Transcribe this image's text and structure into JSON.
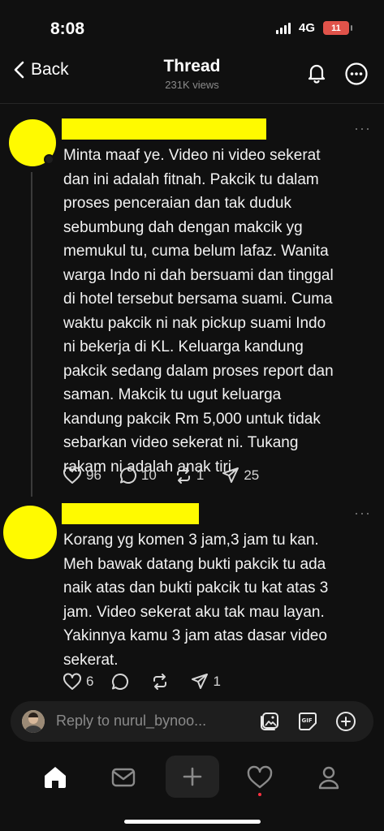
{
  "status_bar": {
    "time": "8:08",
    "network": "4G",
    "battery": "11"
  },
  "header": {
    "back_label": "Back",
    "title": "Thread",
    "views": "231K views"
  },
  "posts": [
    {
      "text": "Minta maaf ye. Video ni video sekerat\ndan ini adalah fitnah. Pakcik tu dalam\nproses penceraian dan tak duduk\nsebumbung dah dengan makcik yg\nmemukul tu, cuma belum lafaz. Wanita\nwarga Indo ni dah bersuami dan tinggal\ndi hotel tersebut bersama suami. Cuma\nwaktu pakcik ni nak pickup suami Indo\nni bekerja di KL. Keluarga kandung\npakcik sedang dalam proses report dan\nsaman. Makcik tu ugut keluarga\nkandung pakcik Rm 5,000 untuk tidak\nsebarkan video sekerat ni. Tukang\nrakam ni adalah anak tiri.",
      "likes": "96",
      "replies": "10",
      "reposts": "1",
      "shares": "25"
    },
    {
      "text": "Korang yg komen 3 jam,3 jam tu kan.\nMeh bawak datang bukti pakcik tu ada\nnaik atas dan bukti pakcik tu kat atas 3\njam. Video sekerat aku tak mau layan.\nYakinnya kamu 3 jam atas dasar video\nsekerat.",
      "likes": "6",
      "replies": "",
      "reposts": "",
      "shares": "1"
    }
  ],
  "reply_bar": {
    "placeholder": "Reply to nurul_bynoo..."
  },
  "icons": {
    "back": "chevron-left-icon",
    "bell": "bell-icon",
    "more": "more-circle-icon",
    "like": "heart-icon",
    "reply": "comment-icon",
    "repost": "repost-icon",
    "share": "send-icon",
    "gallery": "gallery-icon",
    "gif": "gif-icon",
    "add": "plus-circle-icon",
    "home": "home-icon",
    "inbox": "inbox-icon",
    "create": "plus-icon",
    "activity": "heart-icon",
    "profile": "profile-icon"
  },
  "colors": {
    "background": "#101010",
    "redaction": "#fffa00",
    "battery": "#e0534a",
    "notification_dot": "#ff3040"
  }
}
